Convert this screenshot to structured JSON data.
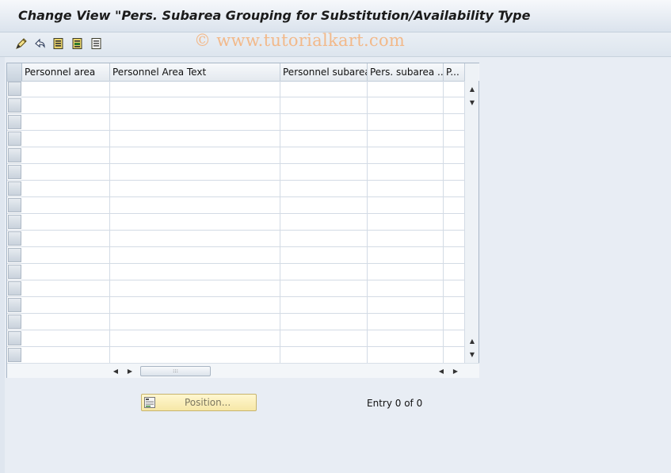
{
  "window": {
    "title": "Change View \"Pers. Subarea Grouping for Substitution/Availability Type"
  },
  "watermark": "© www.tutorialkart.com",
  "toolbar": {
    "buttons": [
      {
        "icon": "display-change-icon"
      },
      {
        "icon": "undo-icon"
      },
      {
        "icon": "select-all-icon"
      },
      {
        "icon": "select-block-icon"
      },
      {
        "icon": "deselect-all-icon"
      }
    ]
  },
  "table": {
    "columns": [
      "Personnel area",
      "Personnel Area Text",
      "Personnel subarea",
      "Pers. subarea ...",
      "P..."
    ],
    "row_count": 17,
    "rows": []
  },
  "footer": {
    "position_label": "Position...",
    "entry_text": "Entry 0 of 0"
  },
  "colors": {
    "title_bg": "#dbe3ed",
    "position_button": "#f6e7a6",
    "watermark": "#f2b98a"
  }
}
